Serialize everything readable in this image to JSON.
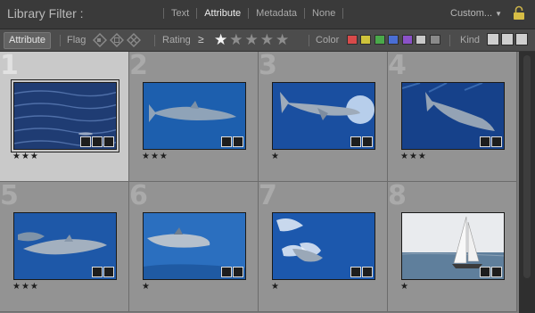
{
  "header": {
    "title": "Library Filter :",
    "tabs": [
      "Text",
      "Attribute",
      "Metadata",
      "None"
    ],
    "active_tab": "Attribute",
    "preset": "Custom...",
    "lock_icon": "lock-icon"
  },
  "attribute_bar": {
    "attribute_label": "Attribute",
    "flag_label": "Flag",
    "rating_label": "Rating",
    "rating_operator": "≥",
    "rating_stars": "★★★★★",
    "rating_value": 1,
    "color_label": "Color",
    "colors": [
      "#d84a4a",
      "#cfc33b",
      "#4aa94a",
      "#4a6ed4",
      "#8b52c8",
      "#c9c9c9",
      "#8a8a8a"
    ],
    "kind_label": "Kind"
  },
  "photos": [
    {
      "number": "1",
      "stars": "★★★",
      "subject": "open-water"
    },
    {
      "number": "2",
      "stars": "★★★",
      "subject": "dolphin"
    },
    {
      "number": "3",
      "stars": "★",
      "subject": "dolphin-splash"
    },
    {
      "number": "4",
      "stars": "★★★",
      "subject": "dolphin-dive"
    },
    {
      "number": "5",
      "stars": "★★★",
      "subject": "dolphin-pair"
    },
    {
      "number": "6",
      "stars": "★",
      "subject": "dolphin-surface"
    },
    {
      "number": "7",
      "stars": "★",
      "subject": "dolphin-wake"
    },
    {
      "number": "8",
      "stars": "★",
      "subject": "sailboat"
    }
  ],
  "selected_photo": "1"
}
